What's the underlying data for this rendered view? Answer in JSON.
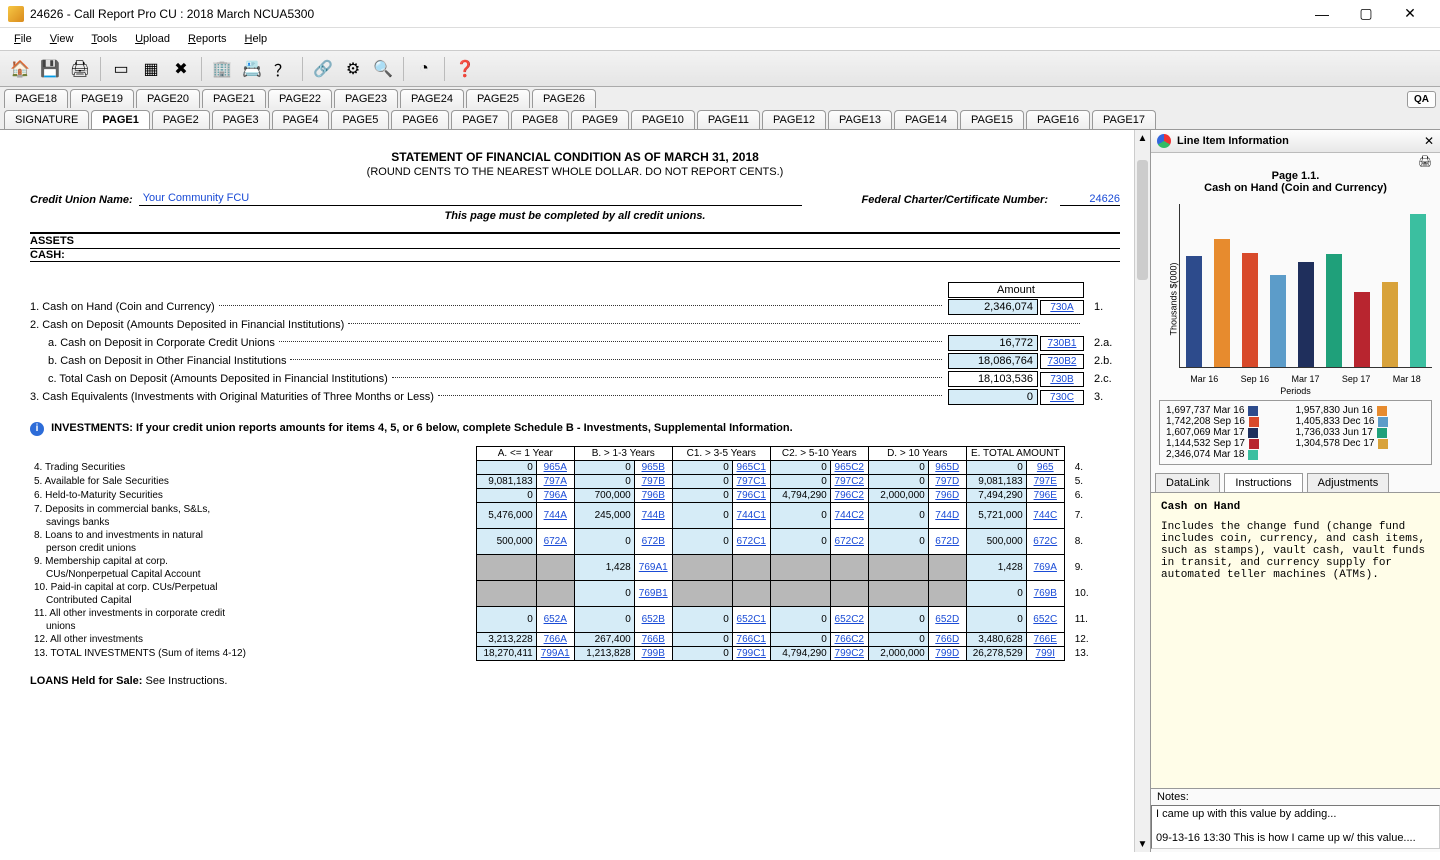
{
  "window": {
    "title": "24626 - Call Report Pro CU :  2018 March NCUA5300",
    "min": "—",
    "max": "▢",
    "close": "✕"
  },
  "menubar": [
    "File",
    "View",
    "Tools",
    "Upload",
    "Reports",
    "Help"
  ],
  "toolbar_icons": [
    "home",
    "save",
    "print",
    "sep",
    "window",
    "grid",
    "delete-x",
    "sep",
    "building",
    "card",
    "help-box",
    "sep",
    "link",
    "dial",
    "zoom",
    "sep",
    "pie",
    "sep",
    "help-round"
  ],
  "tabbar_top": [
    "PAGE18",
    "PAGE19",
    "PAGE20",
    "PAGE21",
    "PAGE22",
    "PAGE23",
    "PAGE24",
    "PAGE25",
    "PAGE26"
  ],
  "tabbar_bottom": [
    "SIGNATURE",
    "PAGE1",
    "PAGE2",
    "PAGE3",
    "PAGE4",
    "PAGE5",
    "PAGE6",
    "PAGE7",
    "PAGE8",
    "PAGE9",
    "PAGE10",
    "PAGE11",
    "PAGE12",
    "PAGE13",
    "PAGE14",
    "PAGE15",
    "PAGE16",
    "PAGE17"
  ],
  "tab_active": "PAGE1",
  "qa": "QA",
  "doc": {
    "title": "STATEMENT OF FINANCIAL CONDITION AS OF MARCH 31, 2018",
    "round": "(ROUND CENTS TO THE NEAREST WHOLE DOLLAR. DO NOT REPORT CENTS.)",
    "cu_label": "Credit Union Name:",
    "cu_name": "Your Community FCU",
    "fed_label": "Federal Charter/Certificate Number:",
    "fed_num": "24626",
    "must": "This page must be completed by all credit unions.",
    "assets": "ASSETS",
    "cash": "CASH:",
    "amount_hdr": "Amount",
    "lines": {
      "l1": {
        "no": "1.",
        "txt": "Cash on Hand (Coin and Currency)",
        "amt": "2,346,074",
        "code": "730A",
        "right": "1."
      },
      "l2": {
        "no": "2.",
        "txt": "Cash on Deposit (Amounts Deposited in Financial Institutions)"
      },
      "l2a": {
        "no": "a.",
        "txt": "Cash on Deposit in Corporate Credit Unions",
        "amt": "16,772",
        "code": "730B1",
        "right": "2.a."
      },
      "l2b": {
        "no": "b.",
        "txt": "Cash on Deposit in Other Financial Institutions",
        "amt": "18,086,764",
        "code": "730B2",
        "right": "2.b."
      },
      "l2c": {
        "no": "c.",
        "txt": "Total Cash on Deposit (Amounts Deposited in Financial Institutions)",
        "amt": "18,103,536",
        "code": "730B",
        "right": "2.c."
      },
      "l3": {
        "no": "3.",
        "txt": "Cash Equivalents (Investments with Original Maturities of Three Months or Less)",
        "amt": "0",
        "code": "730C",
        "right": "3."
      }
    },
    "inv_hdr": "INVESTMENTS: If your credit union reports amounts for items 4, 5, or 6 below, complete Schedule B - Investments, Supplemental Information.",
    "cols": [
      "A. <= 1 Year",
      "B. > 1-3 Years",
      "C1. > 3-5 Years",
      "C2. > 5-10 Years",
      "D. > 10 Years",
      "E. TOTAL AMOUNT"
    ],
    "rows": [
      {
        "no": "4.",
        "label": "Trading Securities",
        "cells": [
          [
            "0",
            "965A"
          ],
          [
            "0",
            "965B"
          ],
          [
            "0",
            "965C1"
          ],
          [
            "0",
            "965C2"
          ],
          [
            "0",
            "965D"
          ],
          [
            "0",
            "965"
          ]
        ],
        "rn": "4."
      },
      {
        "no": "5.",
        "label": "Available for Sale Securities",
        "cells": [
          [
            "9,081,183",
            "797A"
          ],
          [
            "0",
            "797B"
          ],
          [
            "0",
            "797C1"
          ],
          [
            "0",
            "797C2"
          ],
          [
            "0",
            "797D"
          ],
          [
            "9,081,183",
            "797E"
          ]
        ],
        "rn": "5."
      },
      {
        "no": "6.",
        "label": "Held-to-Maturity Securities",
        "cells": [
          [
            "0",
            "796A"
          ],
          [
            "700,000",
            "796B"
          ],
          [
            "0",
            "796C1"
          ],
          [
            "4,794,290",
            "796C2"
          ],
          [
            "2,000,000",
            "796D"
          ],
          [
            "7,494,290",
            "796E"
          ]
        ],
        "rn": "6."
      },
      {
        "no": "7.",
        "label": "Deposits in commercial banks, S&Ls,",
        "label2": "savings banks",
        "cells": [
          [
            "5,476,000",
            "744A"
          ],
          [
            "245,000",
            "744B"
          ],
          [
            "0",
            "744C1"
          ],
          [
            "0",
            "744C2"
          ],
          [
            "0",
            "744D"
          ],
          [
            "5,721,000",
            "744C"
          ]
        ],
        "rn": "7."
      },
      {
        "no": "8.",
        "label": "Loans to and investments in natural",
        "label2": "person credit unions",
        "cells": [
          [
            "500,000",
            "672A"
          ],
          [
            "0",
            "672B"
          ],
          [
            "0",
            "672C1"
          ],
          [
            "0",
            "672C2"
          ],
          [
            "0",
            "672D"
          ],
          [
            "500,000",
            "672C"
          ]
        ],
        "rn": "8."
      },
      {
        "no": "9.",
        "label": "Membership capital at corp.",
        "label2": "CUs/Nonperpetual Capital Account",
        "cells": [
          [
            "g",
            "g"
          ],
          [
            "1,428",
            "769A1"
          ],
          [
            "g",
            "g"
          ],
          [
            "g",
            "g"
          ],
          [
            "g",
            "g"
          ],
          [
            "1,428",
            "769A"
          ]
        ],
        "rn": "9."
      },
      {
        "no": "10.",
        "label": "Paid-in capital at corp. CUs/Perpetual",
        "label2": "Contributed Capital",
        "cells": [
          [
            "g",
            "g"
          ],
          [
            "0",
            "769B1"
          ],
          [
            "g",
            "g"
          ],
          [
            "g",
            "g"
          ],
          [
            "g",
            "g"
          ],
          [
            "0",
            "769B"
          ]
        ],
        "rn": "10."
      },
      {
        "no": "11.",
        "label": "All other investments in corporate credit",
        "label2": "unions",
        "cells": [
          [
            "0",
            "652A"
          ],
          [
            "0",
            "652B"
          ],
          [
            "0",
            "652C1"
          ],
          [
            "0",
            "652C2"
          ],
          [
            "0",
            "652D"
          ],
          [
            "0",
            "652C"
          ]
        ],
        "rn": "11."
      },
      {
        "no": "12.",
        "label": "All other investments",
        "cells": [
          [
            "3,213,228",
            "766A"
          ],
          [
            "267,400",
            "766B"
          ],
          [
            "0",
            "766C1"
          ],
          [
            "0",
            "766C2"
          ],
          [
            "0",
            "766D"
          ],
          [
            "3,480,628",
            "766E"
          ]
        ],
        "rn": "12."
      },
      {
        "no": "13.",
        "label": "TOTAL INVESTMENTS (Sum of items 4-12)",
        "cells": [
          [
            "18,270,411",
            "799A1"
          ],
          [
            "1,213,828",
            "799B"
          ],
          [
            "0",
            "799C1"
          ],
          [
            "4,794,290",
            "799C2"
          ],
          [
            "2,000,000",
            "799D"
          ],
          [
            "26,278,529",
            "799I"
          ]
        ],
        "rn": "13."
      }
    ],
    "loans_held": "LOANS Held for Sale:",
    "loans_held_see": " See Instructions."
  },
  "side": {
    "title": "Line Item Information",
    "page": "Page 1.1.",
    "item": "Cash on Hand (Coin and Currency)",
    "ylabel": "Thousands $(000)",
    "xlabel": "Periods",
    "xticks": [
      "Mar 16",
      "Sep 16",
      "Mar 17",
      "Sep 17",
      "Mar 18"
    ],
    "legend": [
      {
        "v": "1,697,737 Mar 16",
        "c": "#2d4b8c"
      },
      {
        "v": "1,957,830 Jun 16",
        "c": "#e78b2e"
      },
      {
        "v": "1,742,208 Sep 16",
        "c": "#d84a2b"
      },
      {
        "v": "1,405,833 Dec 16",
        "c": "#5c9cc9"
      },
      {
        "v": "1,607,069 Mar 17",
        "c": "#1f2f5c"
      },
      {
        "v": "1,736,033 Jun 17",
        "c": "#1fa07a"
      },
      {
        "v": "1,144,532 Sep 17",
        "c": "#b8252f"
      },
      {
        "v": "1,304,578 Dec 17",
        "c": "#d8a23a"
      },
      {
        "v": "2,346,074 Mar 18",
        "c": "#3bbfa0"
      }
    ],
    "sidetabs": [
      "DataLink",
      "Instructions",
      "Adjustments"
    ],
    "sidetab_active": "Instructions",
    "instr_title": "Cash on Hand",
    "instr_body": "Includes the change fund (change fund includes coin, currency, and cash items, such as stamps), vault cash, vault funds in transit, and currency supply for automated teller machines (ATMs).",
    "notes_label": "Notes:",
    "notes_text": "I came up with this value by adding...\n\n09-13-16 13:30 This is how I came up w/ this value...."
  },
  "chart_data": {
    "type": "bar",
    "title": "Page 1.1. Cash on Hand (Coin and Currency)",
    "xlabel": "Periods",
    "ylabel": "Thousands $(000)",
    "categories": [
      "Mar 16",
      "Jun 16",
      "Sep 16",
      "Dec 16",
      "Mar 17",
      "Jun 17",
      "Sep 17",
      "Dec 17",
      "Mar 18"
    ],
    "values": [
      1697737,
      1957830,
      1742208,
      1405833,
      1607069,
      1736033,
      1144532,
      1304578,
      2346074
    ],
    "colors": [
      "#2d4b8c",
      "#e78b2e",
      "#d84a2b",
      "#5c9cc9",
      "#1f2f5c",
      "#1fa07a",
      "#b8252f",
      "#d8a23a",
      "#3bbfa0"
    ],
    "ylim": [
      0,
      2500000
    ]
  }
}
